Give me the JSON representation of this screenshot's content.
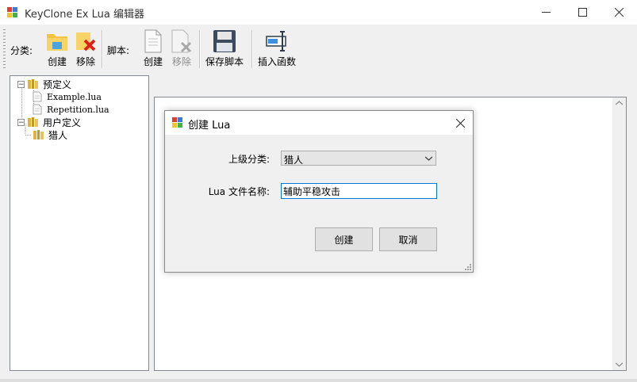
{
  "window": {
    "title": "KeyClone Ex Lua 编辑器"
  },
  "toolbar": {
    "category_label": "分类:",
    "category_create": "创建",
    "category_remove": "移除",
    "script_label": "脚本:",
    "script_create": "创建",
    "script_remove": "移除",
    "save_script": "保存脚本",
    "insert_function": "插入函数"
  },
  "tree": {
    "groups": [
      {
        "label": "预定义",
        "expanded": true,
        "children": [
          "Example.lua",
          "Repetition.lua"
        ]
      },
      {
        "label": "用户定义",
        "expanded": true,
        "children": [
          "猎人"
        ]
      }
    ]
  },
  "dialog": {
    "title": "创建 Lua",
    "parent_label": "上级分类:",
    "parent_value": "猎人",
    "filename_label": "Lua 文件名称:",
    "filename_value": "辅助平稳攻击",
    "ok_label": "创建",
    "cancel_label": "取消"
  }
}
